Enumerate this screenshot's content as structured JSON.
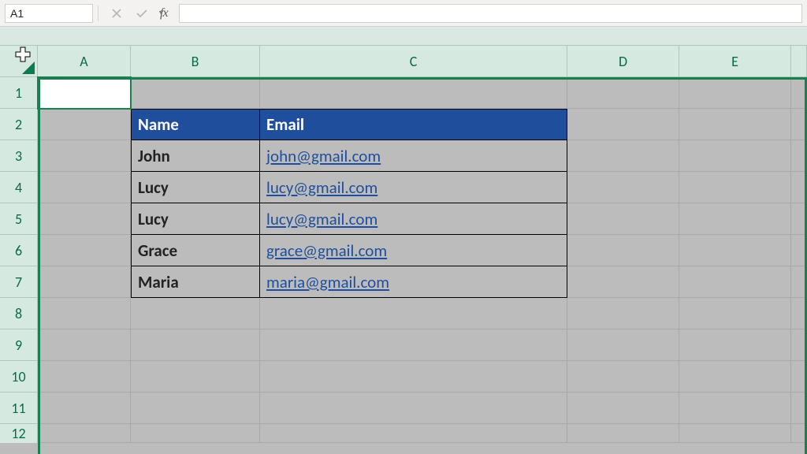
{
  "formula_bar": {
    "name_box": "A1",
    "fx_label": "fx",
    "formula_value": ""
  },
  "columns": [
    "A",
    "B",
    "C",
    "D",
    "E"
  ],
  "rows": [
    "1",
    "2",
    "3",
    "4",
    "5",
    "6",
    "7",
    "8",
    "9",
    "10",
    "11",
    "12"
  ],
  "table": {
    "headers": {
      "name": "Name",
      "email": "Email"
    },
    "rows": [
      {
        "name": "John",
        "email": "john@gmail.com"
      },
      {
        "name": "Lucy",
        "email": "lucy@gmail.com"
      },
      {
        "name": "Lucy",
        "email": "lucy@gmail.com"
      },
      {
        "name": "Grace",
        "email": "grace@gmail.com"
      },
      {
        "name": "Maria",
        "email": "maria@gmail.com"
      }
    ]
  },
  "colors": {
    "header_bg": "#1f4e9c",
    "selection_green": "#1a7f4e",
    "col_row_hdr_bg": "#d5e9e1",
    "link": "#1f4e9c"
  }
}
